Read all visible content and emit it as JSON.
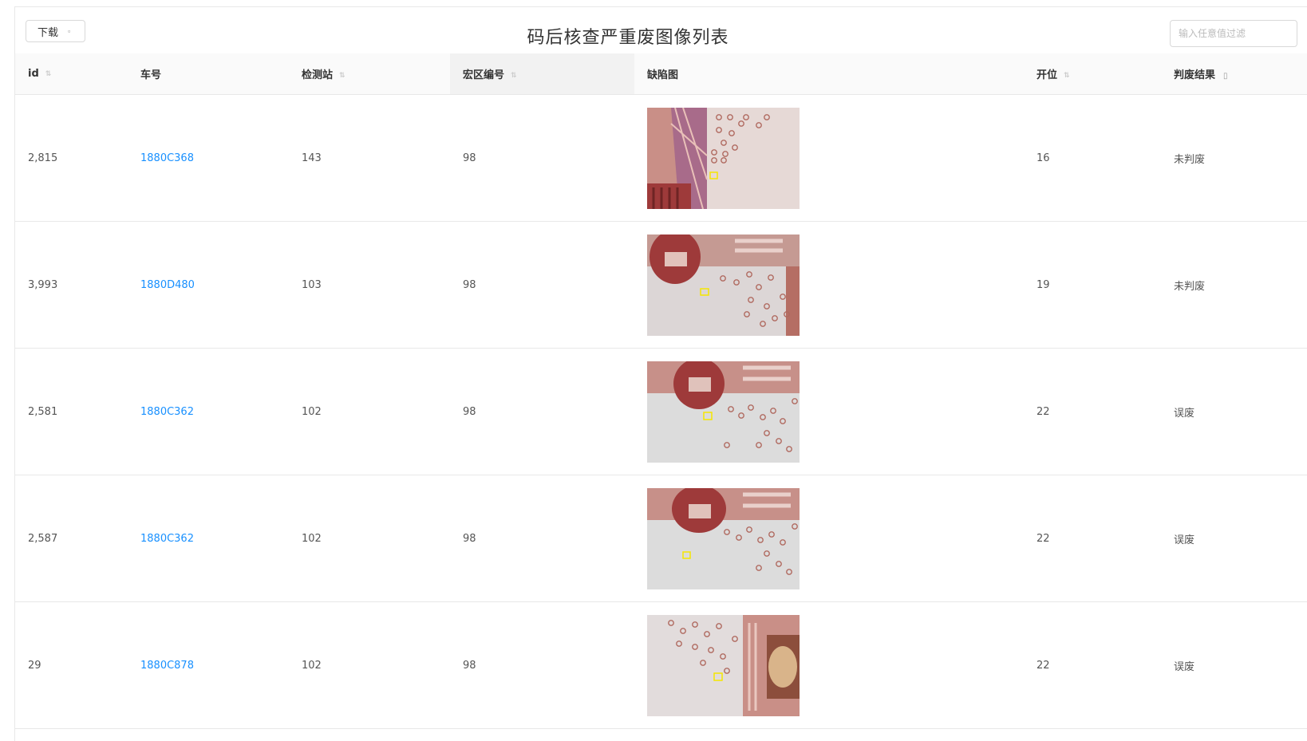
{
  "header": {
    "title": "码后核查严重废图像列表",
    "download_label": "下载",
    "search_placeholder": "输入任意值过滤"
  },
  "table": {
    "columns": [
      {
        "key": "id",
        "label": "id",
        "sortable": true
      },
      {
        "key": "car",
        "label": "车号",
        "sortable": false
      },
      {
        "key": "station",
        "label": "检测站",
        "sortable": true
      },
      {
        "key": "macro",
        "label": "宏区编号",
        "sortable": true
      },
      {
        "key": "image",
        "label": "缺陷图",
        "sortable": false
      },
      {
        "key": "pos",
        "label": "开位",
        "sortable": true
      },
      {
        "key": "result",
        "label": "判废结果",
        "sortable": false,
        "filter": true
      }
    ],
    "rows": [
      {
        "id": "2,815",
        "car": "1880C368",
        "station": "143",
        "macro": "98",
        "pos": "16",
        "result": "未判废",
        "variant": "a"
      },
      {
        "id": "3,993",
        "car": "1880D480",
        "station": "103",
        "macro": "98",
        "pos": "19",
        "result": "未判废",
        "variant": "b"
      },
      {
        "id": "2,581",
        "car": "1880C362",
        "station": "102",
        "macro": "98",
        "pos": "22",
        "result": "误废",
        "variant": "c"
      },
      {
        "id": "2,587",
        "car": "1880C362",
        "station": "102",
        "macro": "98",
        "pos": "22",
        "result": "误废",
        "variant": "d"
      },
      {
        "id": "29",
        "car": "1880C878",
        "station": "102",
        "macro": "98",
        "pos": "22",
        "result": "误废",
        "variant": "e"
      }
    ]
  },
  "colors": {
    "link": "#1890ff",
    "header_bg": "#fafafa",
    "note_red": "#9e3a3a",
    "marker": "#f5e600"
  }
}
